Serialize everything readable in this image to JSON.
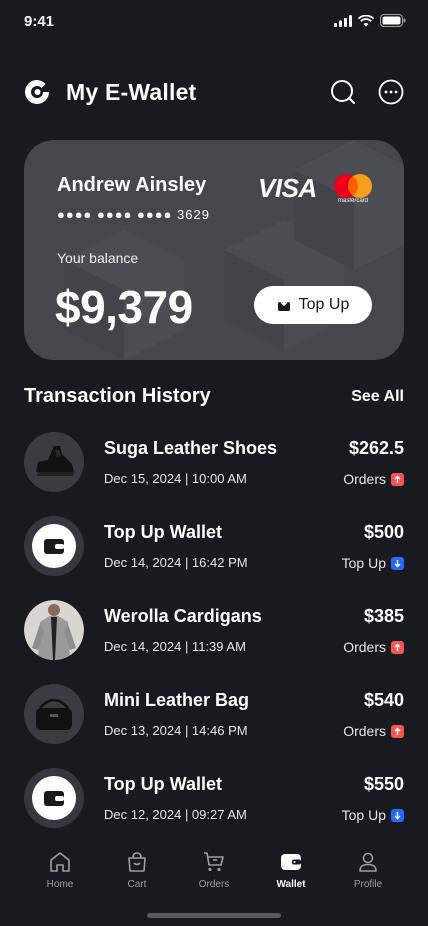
{
  "status": {
    "time": "9:41"
  },
  "header": {
    "title": "My E-Wallet"
  },
  "card": {
    "holder": "Andrew Ainsley",
    "number_masked": "●●●● ●●●● ●●●● 3629",
    "visa_label": "VISA",
    "mastercard_label": "mastercard",
    "balance_label": "Your balance",
    "balance": "$9,379",
    "topup_label": "Top Up"
  },
  "history": {
    "title": "Transaction History",
    "see_all": "See All",
    "items": [
      {
        "name": "Suga Leather Shoes",
        "date": "Dec 15, 2024 | 10:00 AM",
        "amount": "$262.5",
        "type": "Orders",
        "icon": "shoe-icon"
      },
      {
        "name": "Top Up Wallet",
        "date": "Dec 14, 2024 | 16:42 PM",
        "amount": "$500",
        "type": "Top Up",
        "icon": "wallet-icon"
      },
      {
        "name": "Werolla Cardigans",
        "date": "Dec 14, 2024 | 11:39 AM",
        "amount": "$385",
        "type": "Orders",
        "icon": "cardigan-icon"
      },
      {
        "name": "Mini Leather Bag",
        "date": "Dec 13, 2024 | 14:46 PM",
        "amount": "$540",
        "type": "Orders",
        "icon": "bag-icon"
      },
      {
        "name": "Top Up Wallet",
        "date": "Dec 12, 2024 | 09:27 AM",
        "amount": "$550",
        "type": "Top Up",
        "icon": "wallet-icon"
      }
    ]
  },
  "nav": {
    "home": "Home",
    "cart": "Cart",
    "orders": "Orders",
    "wallet": "Wallet",
    "profile": "Profile",
    "active": "wallet"
  },
  "colors": {
    "background": "#181a20",
    "card": "#45474d",
    "orders_badge": "#f75555",
    "topup_badge": "#246bfd"
  }
}
